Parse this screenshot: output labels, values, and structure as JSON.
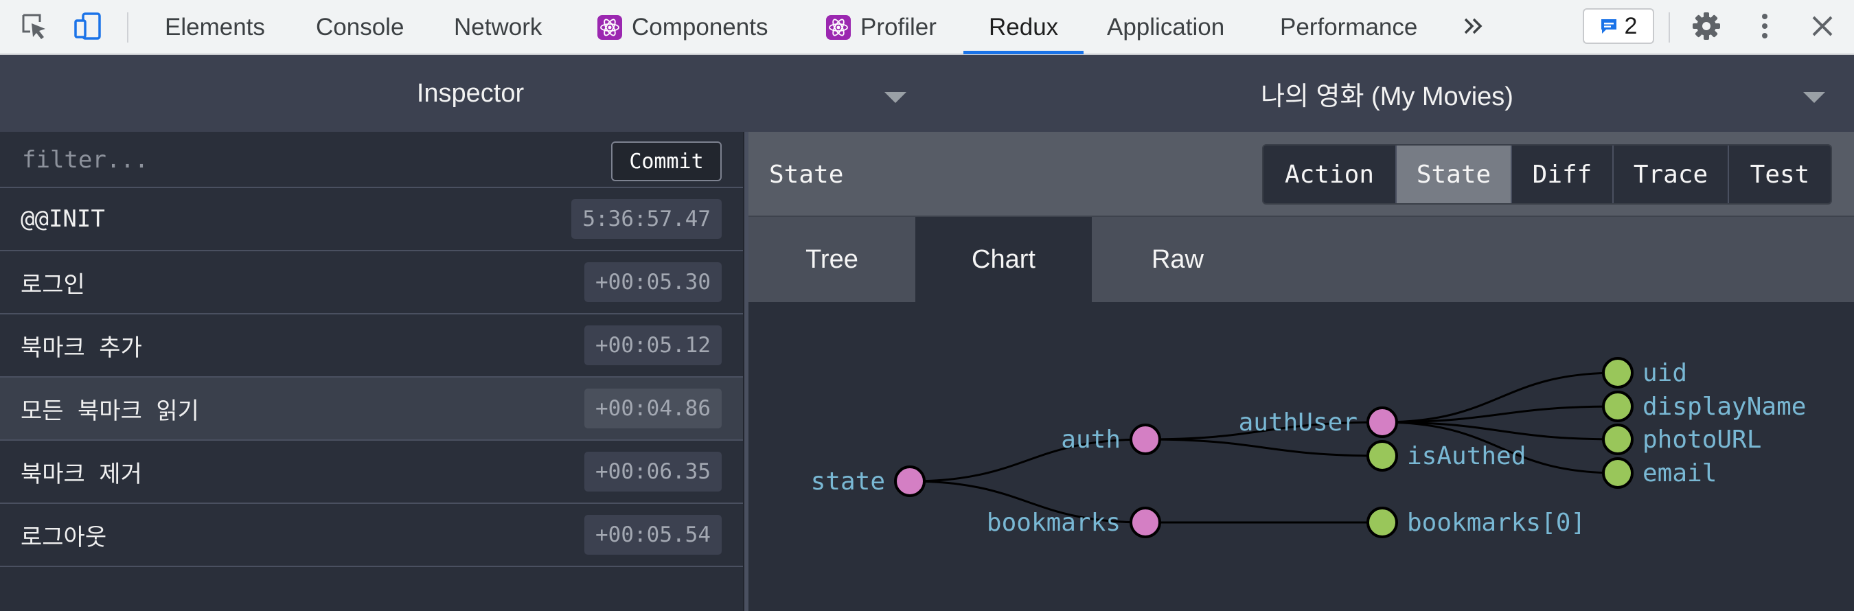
{
  "devtools": {
    "tabs": [
      {
        "label": "Elements",
        "react": false,
        "active": false
      },
      {
        "label": "Console",
        "react": false,
        "active": false
      },
      {
        "label": "Network",
        "react": false,
        "active": false
      },
      {
        "label": "Components",
        "react": true,
        "active": false
      },
      {
        "label": "Profiler",
        "react": true,
        "active": false
      },
      {
        "label": "Redux",
        "react": false,
        "active": true
      },
      {
        "label": "Application",
        "react": false,
        "active": false
      },
      {
        "label": "Performance",
        "react": false,
        "active": false
      }
    ],
    "more_icon": "double-chevron-right-icon",
    "issues_count": "2",
    "accent": "#1a73e8"
  },
  "redux_header": {
    "left_title": "Inspector",
    "right_title": "나의 영화 (My Movies)"
  },
  "action_list": {
    "filter_placeholder": "filter...",
    "commit_label": "Commit",
    "actions": [
      {
        "name": "@@INIT",
        "time": "5:36:57.47",
        "selected": false
      },
      {
        "name": "로그인",
        "time": "+00:05.30",
        "selected": false
      },
      {
        "name": "북마크 추가",
        "time": "+00:05.12",
        "selected": false
      },
      {
        "name": "모든 북마크 읽기",
        "time": "+00:04.86",
        "selected": true
      },
      {
        "name": "북마크 제거",
        "time": "+00:06.35",
        "selected": false
      },
      {
        "name": "로그아웃",
        "time": "+00:05.54",
        "selected": false
      }
    ]
  },
  "monitor": {
    "title": "State",
    "tabs": [
      "Action",
      "State",
      "Diff",
      "Trace",
      "Test"
    ],
    "active_tab": "State",
    "view_tabs": [
      "Tree",
      "Chart",
      "Raw"
    ],
    "active_view": "Chart"
  },
  "state_chart": {
    "node_colors": {
      "branch": "#d47fc4",
      "leaf": "#99c65a"
    },
    "nodes": {
      "state": {
        "label": "state",
        "kind": "branch"
      },
      "auth": {
        "label": "auth",
        "kind": "branch"
      },
      "bookmarks": {
        "label": "bookmarks",
        "kind": "branch"
      },
      "authUser": {
        "label": "authUser",
        "kind": "branch"
      },
      "isAuthed": {
        "label": "isAuthed",
        "kind": "leaf"
      },
      "bookmarks0": {
        "label": "bookmarks[0]",
        "kind": "leaf"
      },
      "uid": {
        "label": "uid",
        "kind": "leaf"
      },
      "displayName": {
        "label": "displayName",
        "kind": "leaf"
      },
      "photoURL": {
        "label": "photoURL",
        "kind": "leaf"
      },
      "email": {
        "label": "email",
        "kind": "leaf"
      }
    },
    "edges": [
      [
        "state",
        "auth"
      ],
      [
        "state",
        "bookmarks"
      ],
      [
        "auth",
        "authUser"
      ],
      [
        "auth",
        "isAuthed"
      ],
      [
        "bookmarks",
        "bookmarks0"
      ],
      [
        "authUser",
        "uid"
      ],
      [
        "authUser",
        "displayName"
      ],
      [
        "authUser",
        "photoURL"
      ],
      [
        "authUser",
        "email"
      ]
    ]
  }
}
